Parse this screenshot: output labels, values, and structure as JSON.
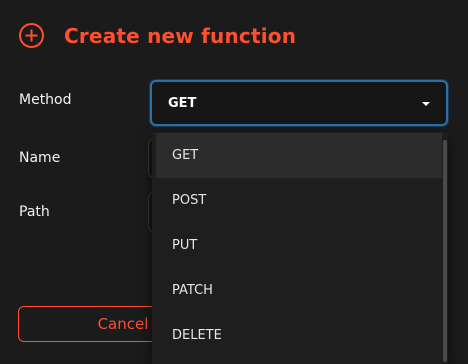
{
  "dialog": {
    "title": "Create new function",
    "icons": {
      "header": "plus-circle-icon",
      "select_caret": "caret-down-icon"
    },
    "colors": {
      "accent": "#ff4f2e",
      "focus_border": "#2f6fa8",
      "background": "#1b1b1b"
    }
  },
  "form": {
    "method_label": "Method",
    "name_label": "Name",
    "path_label": "Path",
    "method_value": "GET"
  },
  "menu": {
    "options": [
      "GET",
      "POST",
      "PUT",
      "PATCH",
      "DELETE"
    ],
    "selected": "GET"
  },
  "footer": {
    "cancel_label": "Cancel"
  }
}
